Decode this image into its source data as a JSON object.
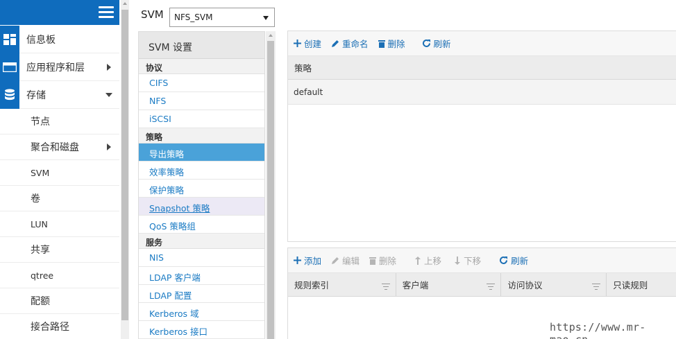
{
  "nav": {
    "items": [
      {
        "label": "信息板",
        "icon": "dashboard-icon"
      },
      {
        "label": "应用程序和层",
        "icon": "applications-icon"
      },
      {
        "label": "存储",
        "icon": "storage-icon"
      }
    ],
    "sub_items": [
      "节点",
      "聚合和磁盘",
      "SVM",
      "卷",
      "LUN",
      "共享",
      "qtree",
      "配额",
      "接合路径"
    ]
  },
  "svm": {
    "label": "SVM",
    "selected": "NFS_SVM"
  },
  "settings": {
    "title": "SVM 设置",
    "sections": [
      {
        "heading": "协议",
        "items": [
          "CIFS",
          "NFS",
          "iSCSI"
        ]
      },
      {
        "heading": "策略",
        "items": [
          "导出策略",
          "效率策略",
          "保护策略",
          "Snapshot 策略",
          "QoS 策略组"
        ]
      },
      {
        "heading": "服务",
        "items": [
          "NIS",
          "LDAP 客户端",
          "LDAP 配置",
          "Kerberos 域",
          "Kerberos 接口"
        ]
      }
    ],
    "selected_item": "导出策略",
    "hovered_item": "Snapshot 策略"
  },
  "policy_panel": {
    "toolbar": {
      "create": "创建",
      "rename": "重命名",
      "delete": "删除",
      "refresh": "刷新"
    },
    "column": "策略",
    "rows": [
      "default"
    ]
  },
  "rules_panel": {
    "toolbar": {
      "add": "添加",
      "edit": "编辑",
      "delete": "删除",
      "move_up": "上移",
      "move_down": "下移",
      "refresh": "刷新"
    },
    "columns": [
      "规则索引",
      "客户端",
      "访问协议",
      "只读规则"
    ]
  },
  "watermark": "https://www.mr-mao.cn",
  "colors": {
    "accent": "#0f6cbd",
    "selected": "#4aa2d9",
    "link": "#1b7bc4",
    "disabled": "#a6a6a6"
  }
}
